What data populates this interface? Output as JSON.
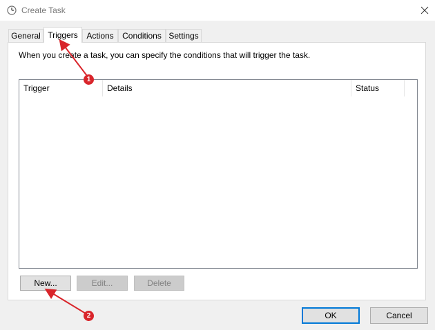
{
  "window": {
    "title": "Create Task"
  },
  "tabs": [
    {
      "label": "General"
    },
    {
      "label": "Triggers"
    },
    {
      "label": "Actions"
    },
    {
      "label": "Conditions"
    },
    {
      "label": "Settings"
    }
  ],
  "active_tab": "Triggers",
  "triggers_panel": {
    "description": "When you create a task, you can specify the conditions that will trigger the task.",
    "columns": [
      "Trigger",
      "Details",
      "Status"
    ],
    "rows": [],
    "buttons": {
      "new": "New...",
      "edit": "Edit...",
      "delete": "Delete"
    }
  },
  "dialog_buttons": {
    "ok": "OK",
    "cancel": "Cancel"
  },
  "annotations": [
    {
      "number": "1"
    },
    {
      "number": "2"
    }
  ],
  "colors": {
    "annotation": "#d9252b",
    "accent": "#0078d7"
  },
  "icons": {
    "title": "task-scheduler-clock-icon",
    "close": "close-icon"
  }
}
